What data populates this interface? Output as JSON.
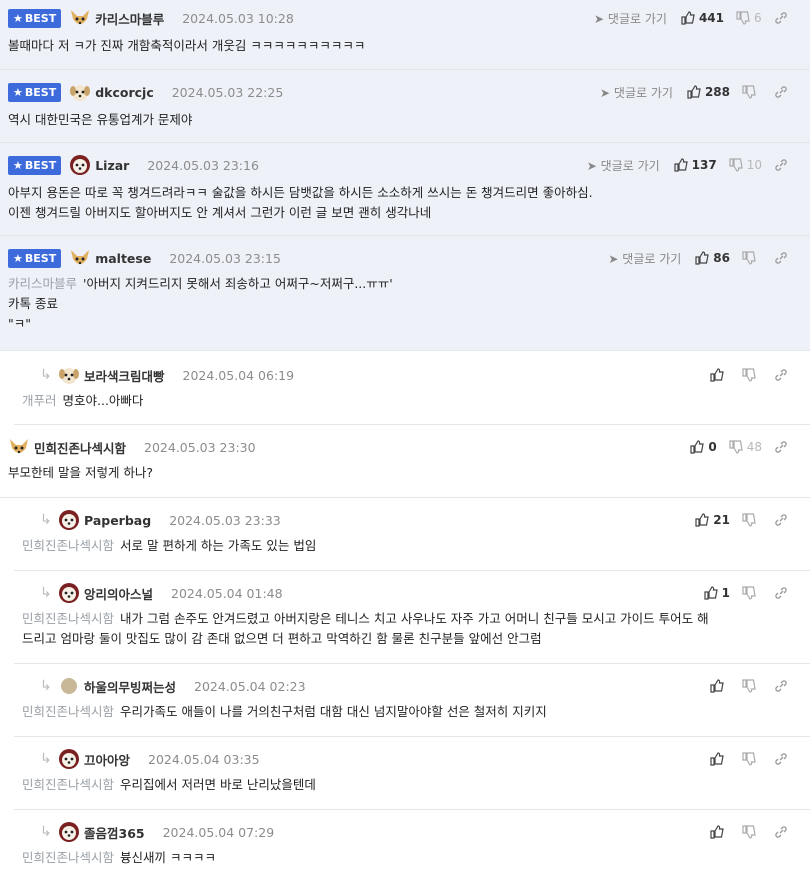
{
  "labels": {
    "best": "BEST",
    "reply_to_comment": "댓글로 가기"
  },
  "colors": {
    "best_badge": "#3e6bdc",
    "best_row_bg": "#eef2f8",
    "divider": "#e4e7ec"
  },
  "best_comments": [
    {
      "nick": "카리스마블루",
      "date": "2024.05.03 10:28",
      "likes": "441",
      "dislikes": "6",
      "avatar": "chihuahua-avatar",
      "lines": [
        "볼때마다 저 ㅋ가 진짜 개함축적이라서 개웃김 ㅋㅋㅋㅋㅋㅋㅋㅋㅋㅋ"
      ]
    },
    {
      "nick": "dkcorcjc",
      "date": "2024.05.03 22:25",
      "likes": "288",
      "dislikes": "",
      "avatar": "puppy-avatar",
      "lines": [
        "역시 대한민국은 유통업계가 문제야"
      ]
    },
    {
      "nick": "Lizar",
      "date": "2024.05.03 23:16",
      "likes": "137",
      "dislikes": "10",
      "avatar": "maltese-avatar",
      "lines": [
        "아부지 용돈은 따로 꼭 챙겨드려라ㅋㅋ 술값을 하시든 담뱃값을 하시든 소소하게 쓰시는 돈 챙겨드리면 좋아하심.",
        "이젠 챙겨드릴 아버지도 할아버지도 안 계셔서 그런가 이런 글 보면 괜히 생각나네"
      ]
    },
    {
      "nick": "maltese",
      "date": "2024.05.03 23:15",
      "likes": "86",
      "dislikes": "",
      "avatar": "chihuahua-avatar",
      "target": "카리스마블루",
      "lines": [
        "'아버지 지켜드리지 못해서 죄송하고 어쩌구~저쩌구...ㅠㅠ'",
        "카톡 종료",
        "\"ㅋ\""
      ]
    }
  ],
  "comments": [
    {
      "reply": true,
      "nick": "보라색크림대빵",
      "date": "2024.05.04 06:19",
      "likes": "",
      "dislikes": "",
      "avatar": "puppy-avatar",
      "target": "개푸러",
      "lines": [
        "명호야...아빠다"
      ]
    },
    {
      "reply": false,
      "nick": "민희진존나섹시함",
      "date": "2024.05.03 23:30",
      "likes": "0",
      "dislikes": "48",
      "avatar": "chihuahua-avatar",
      "lines": [
        "부모한테 말을 저렇게 하나?"
      ]
    },
    {
      "reply": true,
      "nick": "Paperbag",
      "date": "2024.05.03 23:33",
      "likes": "21",
      "dislikes": "",
      "avatar": "maltese-avatar",
      "target": "민희진존나섹시함",
      "lines": [
        "서로 말 편하게 하는 가족도 있는 법임"
      ]
    },
    {
      "reply": true,
      "nick": "앙리의아스널",
      "date": "2024.05.04 01:48",
      "likes": "1",
      "dislikes": "",
      "avatar": "maltese-avatar",
      "target": "민희진존나섹시함",
      "lines": [
        "내가 그럼 손주도 안겨드렸고 아버지랑은 테니스 치고 사우나도 자주 가고 어머니 친구들 모시고 가이드 투어도 해",
        "드리고 엄마랑 둘이 맛집도 많이 감 존대 없으면 더 편하고 막역하긴 함 물론 친구분들 앞에선 안그럼"
      ]
    },
    {
      "reply": true,
      "nick": "하울의무빙쩌는성",
      "date": "2024.05.04 02:23",
      "likes": "",
      "dislikes": "",
      "avatar": "circle-avatar",
      "target": "민희진존나섹시함",
      "lines": [
        "우리가족도 애들이 나를 거의친구처럼 대함 대신 넘지말아야할 선은 철저히 지키지"
      ]
    },
    {
      "reply": true,
      "nick": "끄아아앙",
      "date": "2024.05.04 03:35",
      "likes": "",
      "dislikes": "",
      "avatar": "maltese-avatar",
      "target": "민희진존나섹시함",
      "lines": [
        "우리집에서 저러면 바로 난리났을텐데"
      ]
    },
    {
      "reply": true,
      "nick": "졸음껌365",
      "date": "2024.05.04 07:29",
      "likes": "",
      "dislikes": "",
      "avatar": "maltese-avatar",
      "target": "민희진존나섹시함",
      "lines": [
        "븅신새끼 ㅋㅋㅋㅋ"
      ]
    }
  ]
}
